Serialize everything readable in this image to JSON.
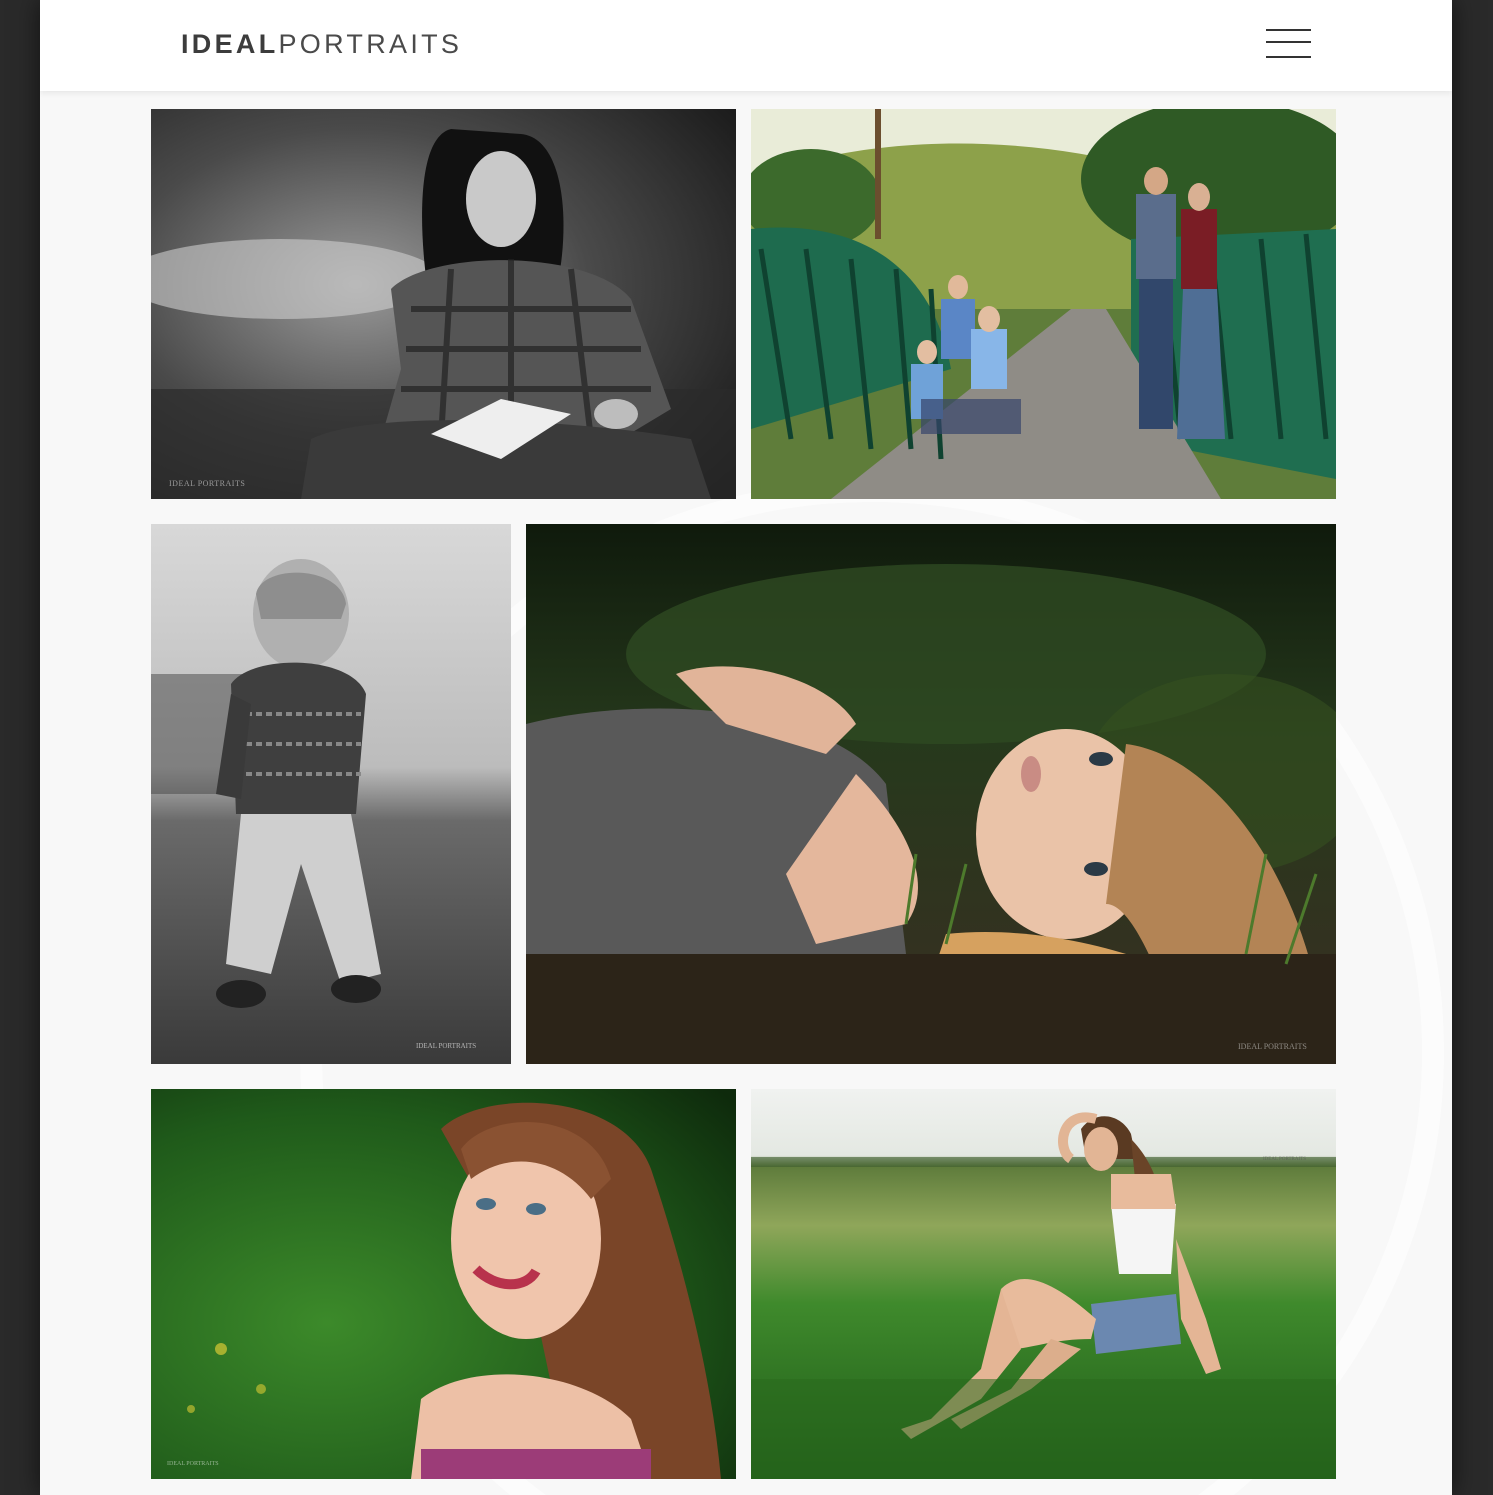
{
  "header": {
    "logo_bold": "IDEAL",
    "logo_light": "PORTRAITS"
  },
  "gallery": {
    "watermark": "IDEAL PORTRAITS",
    "photos": [
      {
        "subject": "woman writing in notebook",
        "style": "black-and-white"
      },
      {
        "subject": "family on green bridge",
        "style": "color"
      },
      {
        "subject": "toddler walking",
        "style": "black-and-white"
      },
      {
        "subject": "woman lying in grass",
        "style": "color"
      },
      {
        "subject": "smiling girl portrait",
        "style": "color"
      },
      {
        "subject": "woman sitting in field",
        "style": "color"
      }
    ]
  },
  "colors": {
    "page_bg": "#f8f8f8",
    "outer_bg": "#2a2a2a",
    "header_bg": "#ffffff",
    "logo_text": "#3c3c3c"
  }
}
